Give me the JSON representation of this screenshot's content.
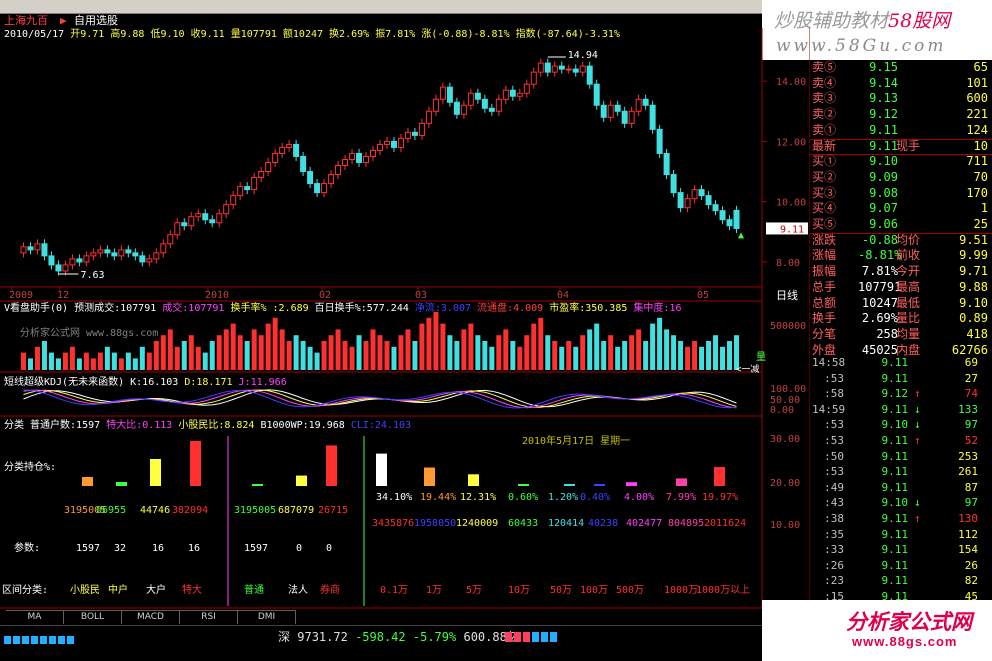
{
  "window": {
    "stock_name": "上海九百",
    "menu": "自用选股"
  },
  "info": {
    "date": "2010/05/17",
    "open": "开9.71",
    "high": "高9.88",
    "low": "低9.10",
    "close": "收9.11",
    "vol": "量107791",
    "amount": "额10247",
    "turnover": "换2.69%",
    "amplitude": "振7.81%",
    "change": "涨(-0.88)-8.81%",
    "index": "指数(-87.64)-3.31%"
  },
  "watermark_top": {
    "line1a": "炒股辅助教材",
    "line1b": "58股网",
    "line2": "www.58Gu.com"
  },
  "watermark_bottom": {
    "line1": "分析家公式网",
    "line2": "www.88gs.com"
  },
  "panel_labels": {
    "vol_indicator": "V看盘助手(0) 预测成交:107791",
    "vol_cj": "成交:107791",
    "vol_hs": "换手率% :2.689",
    "vol_bh": "百日换手%:577.244",
    "vol_zx": "净流:3.007",
    "vol_lt": "流通盘:4.009",
    "vol_syl": "市盈率:350.385",
    "vol_jzd": "集中度:16",
    "vol_watermark": "分析家公式网 www.88gs.com",
    "vol_side_label": "量",
    "vol_side_label2": "<一减",
    "kdj_title": "短线超级KDJ(无未来函数)",
    "kdj_k": "K:16.103",
    "kdj_d": "D:18.171",
    "kdj_j": "J:11.966",
    "hold_title": "分类",
    "hold_ptr": "普通户数:1597",
    "hold_tdb": "特大比:0.113",
    "hold_xgm": "小股民比:8.824",
    "hold_b1000": "B1000WP:19.968",
    "hold_other": "CLI:24.103",
    "hold_pct_label": "分类持仓%:",
    "hold_param_label": "参数:",
    "hold_range_label": "区间分类:",
    "hold_date": "2010年5月17日 星期一",
    "period_label": "日线",
    "low_marker": "7.63",
    "high_marker": "14.94",
    "current_price_tag": "9.11"
  },
  "hold_groups": {
    "g1_names": [
      "小股民",
      "中户",
      "大户",
      "特大"
    ],
    "g1_vals": [
      "3195005",
      "06955",
      "44746",
      "382094"
    ],
    "g1_params": [
      "1597",
      "32",
      "16",
      "16"
    ],
    "g2_names": [
      "普通",
      "法人",
      "券商"
    ],
    "g2_vals": [
      "3195005",
      "687079",
      "26715"
    ],
    "g2_params": [
      "1597",
      "0",
      "0"
    ],
    "g3_pcts": [
      "34.10%",
      "19.44%",
      "12.31%",
      "0.60%",
      "1.20%",
      "0.40%",
      "4.00%",
      "7.99%",
      "19.97%"
    ],
    "g3_vals": [
      "3435876",
      "1958050",
      "1240009",
      "60433",
      "120414",
      "40238",
      "402477",
      "804895",
      "2011624"
    ],
    "g3_names": [
      "0.1万",
      "1万",
      "5万",
      "10万",
      "50万",
      "100万",
      "500万",
      "1000万",
      "1000万以上"
    ]
  },
  "tabs": [
    "MA",
    "BOLL",
    "MACD",
    "RSI",
    "DMI"
  ],
  "status": {
    "market": "深",
    "index": "9731.72",
    "change": "-598.42",
    "pct": "-5.79%",
    "amount": "600.88亿"
  },
  "quote": {
    "sell": [
      {
        "l": "卖⑤",
        "p": "9.15",
        "v": "65"
      },
      {
        "l": "卖④",
        "p": "9.14",
        "v": "101"
      },
      {
        "l": "卖③",
        "p": "9.13",
        "v": "600"
      },
      {
        "l": "卖②",
        "p": "9.12",
        "v": "221"
      },
      {
        "l": "卖①",
        "p": "9.11",
        "v": "124"
      }
    ],
    "last": {
      "l": "最新",
      "p": "9.11",
      "l2": "现手",
      "v": "10"
    },
    "buy": [
      {
        "l": "买①",
        "p": "9.10",
        "v": "711"
      },
      {
        "l": "买②",
        "p": "9.09",
        "v": "70"
      },
      {
        "l": "买③",
        "p": "9.08",
        "v": "170"
      },
      {
        "l": "买④",
        "p": "9.07",
        "v": "1"
      },
      {
        "l": "买⑤",
        "p": "9.06",
        "v": "25"
      }
    ],
    "stats": [
      {
        "l": "涨跌",
        "p": "-0.88",
        "l2": "均价",
        "v": "9.51"
      },
      {
        "l": "涨幅",
        "p": "-8.81%",
        "l2": "前收",
        "v": "9.99"
      },
      {
        "l": "振幅",
        "p": "7.81%",
        "l2": "今开",
        "v": "9.71"
      },
      {
        "l": "总手",
        "p": "107791",
        "l2": "最高",
        "v": "9.88"
      },
      {
        "l": "总额",
        "p": "10247",
        "l2": "最低",
        "v": "9.10"
      },
      {
        "l": "换手",
        "p": "2.69%",
        "l2": "量比",
        "v": "0.89"
      },
      {
        "l": "分笔",
        "p": "258",
        "l2": "均量",
        "v": "418"
      },
      {
        "l": "外盘",
        "p": "45025",
        "l2": "内盘",
        "v": "62766"
      }
    ]
  },
  "ticks": [
    {
      "t": "14:58",
      "p": "9.11",
      "a": "",
      "v": "69"
    },
    {
      "t": ":53",
      "p": "9.11",
      "a": "",
      "v": "27"
    },
    {
      "t": ":58",
      "p": "9.12",
      "a": "↑",
      "v": "74"
    },
    {
      "t": "14:59",
      "p": "9.11",
      "a": "↓",
      "v": "133"
    },
    {
      "t": ":53",
      "p": "9.10",
      "a": "↓",
      "v": "97"
    },
    {
      "t": ":53",
      "p": "9.11",
      "a": "↑",
      "v": "52"
    },
    {
      "t": ":50",
      "p": "9.11",
      "a": "",
      "v": "253"
    },
    {
      "t": ":53",
      "p": "9.11",
      "a": "",
      "v": "261"
    },
    {
      "t": ":49",
      "p": "9.11",
      "a": "",
      "v": "87"
    },
    {
      "t": ":43",
      "p": "9.10",
      "a": "↓",
      "v": "97"
    },
    {
      "t": ":38",
      "p": "9.11",
      "a": "↑",
      "v": "130"
    },
    {
      "t": ":35",
      "p": "9.11",
      "a": "",
      "v": "112"
    },
    {
      "t": ":33",
      "p": "9.11",
      "a": "",
      "v": "154"
    },
    {
      "t": ":26",
      "p": "9.11",
      "a": "",
      "v": "26"
    },
    {
      "t": ":23",
      "p": "9.11",
      "a": "",
      "v": "82"
    },
    {
      "t": ":15",
      "p": "9.11",
      "a": "",
      "v": "45"
    }
  ],
  "chart_data": {
    "type": "candlestick",
    "title": "上海九百",
    "ylim": [
      7.2,
      15.3
    ],
    "yticks": [
      8.0,
      10.0,
      12.0,
      14.0
    ],
    "xlabels": [
      "2009",
      "12",
      "2010",
      "02",
      "03",
      "04",
      "05"
    ],
    "vol_yticks": [
      "500000"
    ],
    "kdj_yticks": [
      "100.00",
      "50.00",
      "0.00"
    ],
    "hold_yticks": [
      "30.00",
      "20.00",
      "10.00"
    ],
    "closes": [
      8.5,
      8.4,
      8.6,
      8.2,
      7.9,
      7.7,
      7.9,
      8.1,
      8.0,
      8.2,
      8.3,
      8.4,
      8.3,
      8.2,
      8.4,
      8.3,
      8.2,
      8.0,
      8.1,
      8.3,
      8.6,
      8.9,
      9.3,
      9.2,
      9.5,
      9.6,
      9.4,
      9.3,
      9.6,
      9.9,
      10.2,
      10.5,
      10.4,
      10.8,
      11.0,
      11.3,
      11.6,
      11.8,
      11.9,
      11.5,
      11.0,
      10.6,
      10.3,
      10.6,
      10.9,
      11.2,
      11.4,
      11.6,
      11.3,
      11.5,
      11.7,
      11.9,
      12.0,
      11.8,
      12.1,
      12.3,
      12.2,
      12.6,
      13.0,
      13.4,
      13.8,
      13.3,
      12.9,
      13.2,
      13.6,
      13.4,
      13.1,
      13.0,
      13.4,
      13.7,
      13.5,
      13.6,
      13.9,
      14.3,
      14.6,
      14.3,
      14.5,
      14.4,
      14.4,
      14.3,
      14.5,
      13.9,
      13.2,
      12.8,
      13.2,
      13.0,
      12.6,
      13.0,
      13.4,
      13.2,
      12.4,
      11.6,
      10.9,
      10.3,
      9.8,
      10.1,
      10.4,
      10.2,
      9.9,
      9.7,
      9.4,
      9.2,
      9.11
    ],
    "opens": [
      8.3,
      8.5,
      8.4,
      8.6,
      8.2,
      7.9,
      7.7,
      7.9,
      8.1,
      8.0,
      8.2,
      8.3,
      8.4,
      8.3,
      8.2,
      8.4,
      8.3,
      8.2,
      8.0,
      8.1,
      8.3,
      8.6,
      8.9,
      9.3,
      9.2,
      9.5,
      9.6,
      9.4,
      9.3,
      9.6,
      9.9,
      10.2,
      10.5,
      10.4,
      10.8,
      11.0,
      11.3,
      11.6,
      11.8,
      11.9,
      11.5,
      11.0,
      10.6,
      10.3,
      10.6,
      10.9,
      11.2,
      11.4,
      11.6,
      11.3,
      11.5,
      11.7,
      11.9,
      12.0,
      11.8,
      12.1,
      12.3,
      12.2,
      12.6,
      13.0,
      13.4,
      13.8,
      13.3,
      12.9,
      13.2,
      13.6,
      13.4,
      13.1,
      13.0,
      13.4,
      13.7,
      13.5,
      13.6,
      13.9,
      14.3,
      14.6,
      14.3,
      14.5,
      14.4,
      14.4,
      14.3,
      14.5,
      13.9,
      13.2,
      12.8,
      13.2,
      13.0,
      12.6,
      13.0,
      13.4,
      13.2,
      12.4,
      11.6,
      10.9,
      10.3,
      9.8,
      10.1,
      10.4,
      10.2,
      9.9,
      9.7,
      9.4,
      9.71
    ],
    "vol": [
      3,
      2,
      4,
      5,
      3,
      2,
      3,
      4,
      2,
      3,
      2,
      3,
      4,
      3,
      2,
      3,
      2,
      4,
      3,
      5,
      6,
      7,
      4,
      5,
      6,
      4,
      3,
      5,
      6,
      7,
      8,
      6,
      5,
      7,
      6,
      8,
      9,
      7,
      5,
      6,
      5,
      4,
      3,
      5,
      6,
      7,
      5,
      4,
      6,
      5,
      7,
      6,
      5,
      4,
      6,
      7,
      5,
      8,
      9,
      10,
      8,
      6,
      5,
      7,
      8,
      6,
      5,
      4,
      6,
      7,
      5,
      4,
      6,
      8,
      9,
      6,
      5,
      4,
      5,
      4,
      6,
      7,
      8,
      5,
      6,
      4,
      5,
      6,
      7,
      5,
      8,
      9,
      7,
      6,
      5,
      4,
      5,
      4,
      5,
      6,
      4,
      5,
      6
    ],
    "hold_g1_pct": [
      9,
      4,
      27,
      45
    ],
    "hold_g2_pct": [
      1,
      9,
      35
    ],
    "hold_g3_pct": [
      34.1,
      19.44,
      12.31,
      0.6,
      1.2,
      0.4,
      4.0,
      7.99,
      19.97
    ]
  }
}
